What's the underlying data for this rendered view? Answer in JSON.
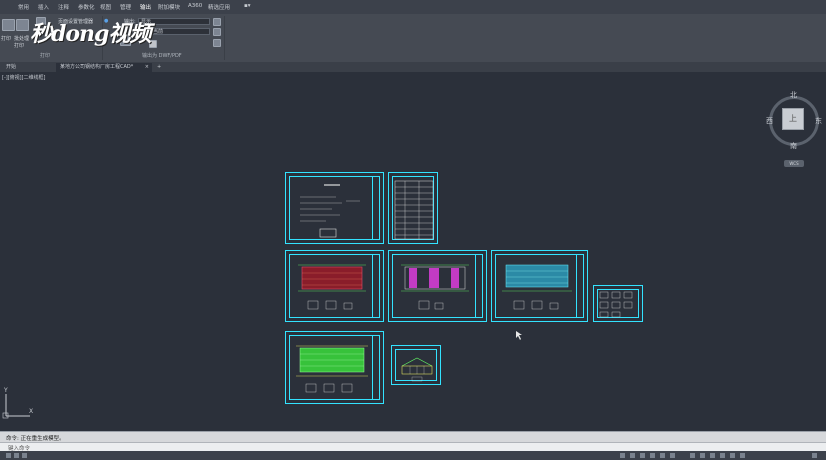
{
  "menubar": {
    "items": [
      "常用",
      "插入",
      "注释",
      "参数化",
      "视图",
      "管理",
      "输出",
      "附加模块",
      "A360",
      "精选应用"
    ]
  },
  "ribbon": {
    "plot_label": "打印",
    "batch_plot_label": "批处理打印",
    "page_setup_label": "页面设置管理器",
    "output_label": "输出:",
    "output_value": "显示",
    "page_setup_value": "当前",
    "group_plot": "打印",
    "group_export": "输出为 DWF/PDF"
  },
  "watermark": "秒dong视频",
  "tabs": {
    "start": "开始",
    "doc": "某地方公司钢结构厂房工程CAD*"
  },
  "viewport": {
    "label": "[-][俯视][二维线框]"
  },
  "viewcube": {
    "north": "北",
    "south": "南",
    "east": "东",
    "west": "西",
    "face": "上",
    "wcs": "WCS"
  },
  "ucs": {
    "x": "X",
    "y": "Y"
  },
  "command": {
    "history": "命令:  正在重生成模型。",
    "placeholder": "键入命令"
  },
  "colors": {
    "sheet_border": "#33e3ff",
    "canvas": "#2b303a"
  }
}
